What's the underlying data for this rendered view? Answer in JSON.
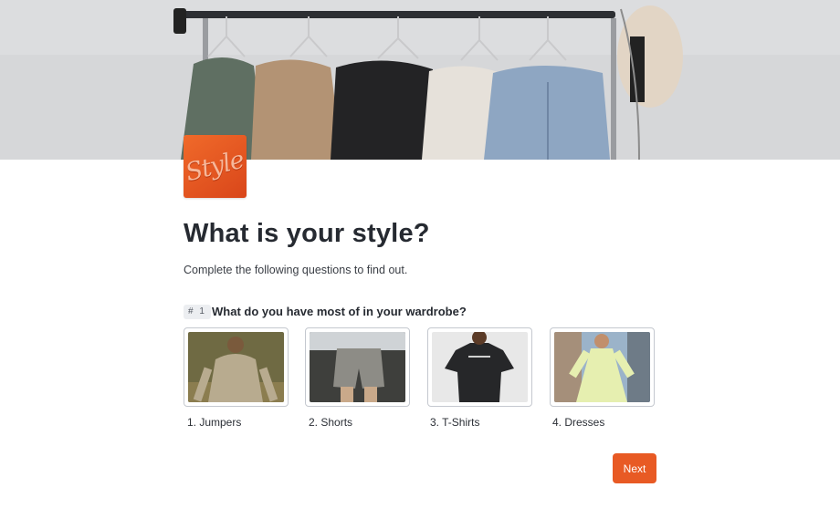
{
  "header": {
    "logo_text": "Style"
  },
  "main": {
    "title": "What is your style?",
    "subtitle": "Complete the following questions to find out."
  },
  "question": {
    "number": "# 1",
    "text": "What do you have most of in your wardrobe?",
    "options": [
      {
        "label": "1. Jumpers"
      },
      {
        "label": "2. Shorts"
      },
      {
        "label": "3. T-Shirts"
      },
      {
        "label": "4. Dresses"
      }
    ]
  },
  "actions": {
    "next_label": "Next"
  },
  "colors": {
    "accent": "#e85a24",
    "text": "#262a31",
    "border": "#c4c8cf"
  }
}
